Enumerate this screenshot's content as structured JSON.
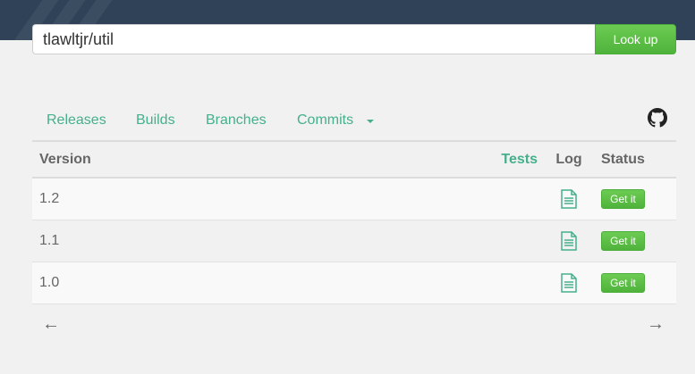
{
  "search": {
    "value": "tlawltjr/util",
    "button_label": "Look up"
  },
  "tabs": [
    {
      "label": "Releases"
    },
    {
      "label": "Builds"
    },
    {
      "label": "Branches"
    },
    {
      "label": "Commits"
    }
  ],
  "icons": {
    "repo": "github-icon",
    "log": "document-icon",
    "tabs_menu": "caret-down-icon"
  },
  "table": {
    "headers": {
      "version": "Version",
      "tests": "Tests",
      "log": "Log",
      "status": "Status"
    },
    "rows": [
      {
        "version": "1.2",
        "status_label": "Get it"
      },
      {
        "version": "1.1",
        "status_label": "Get it"
      },
      {
        "version": "1.0",
        "status_label": "Get it"
      }
    ]
  },
  "pager": {
    "prev": "←",
    "next": "→"
  },
  "colors": {
    "header_bar": "#2f4258",
    "accent": "#45b08a",
    "button": "#5cbd45"
  }
}
